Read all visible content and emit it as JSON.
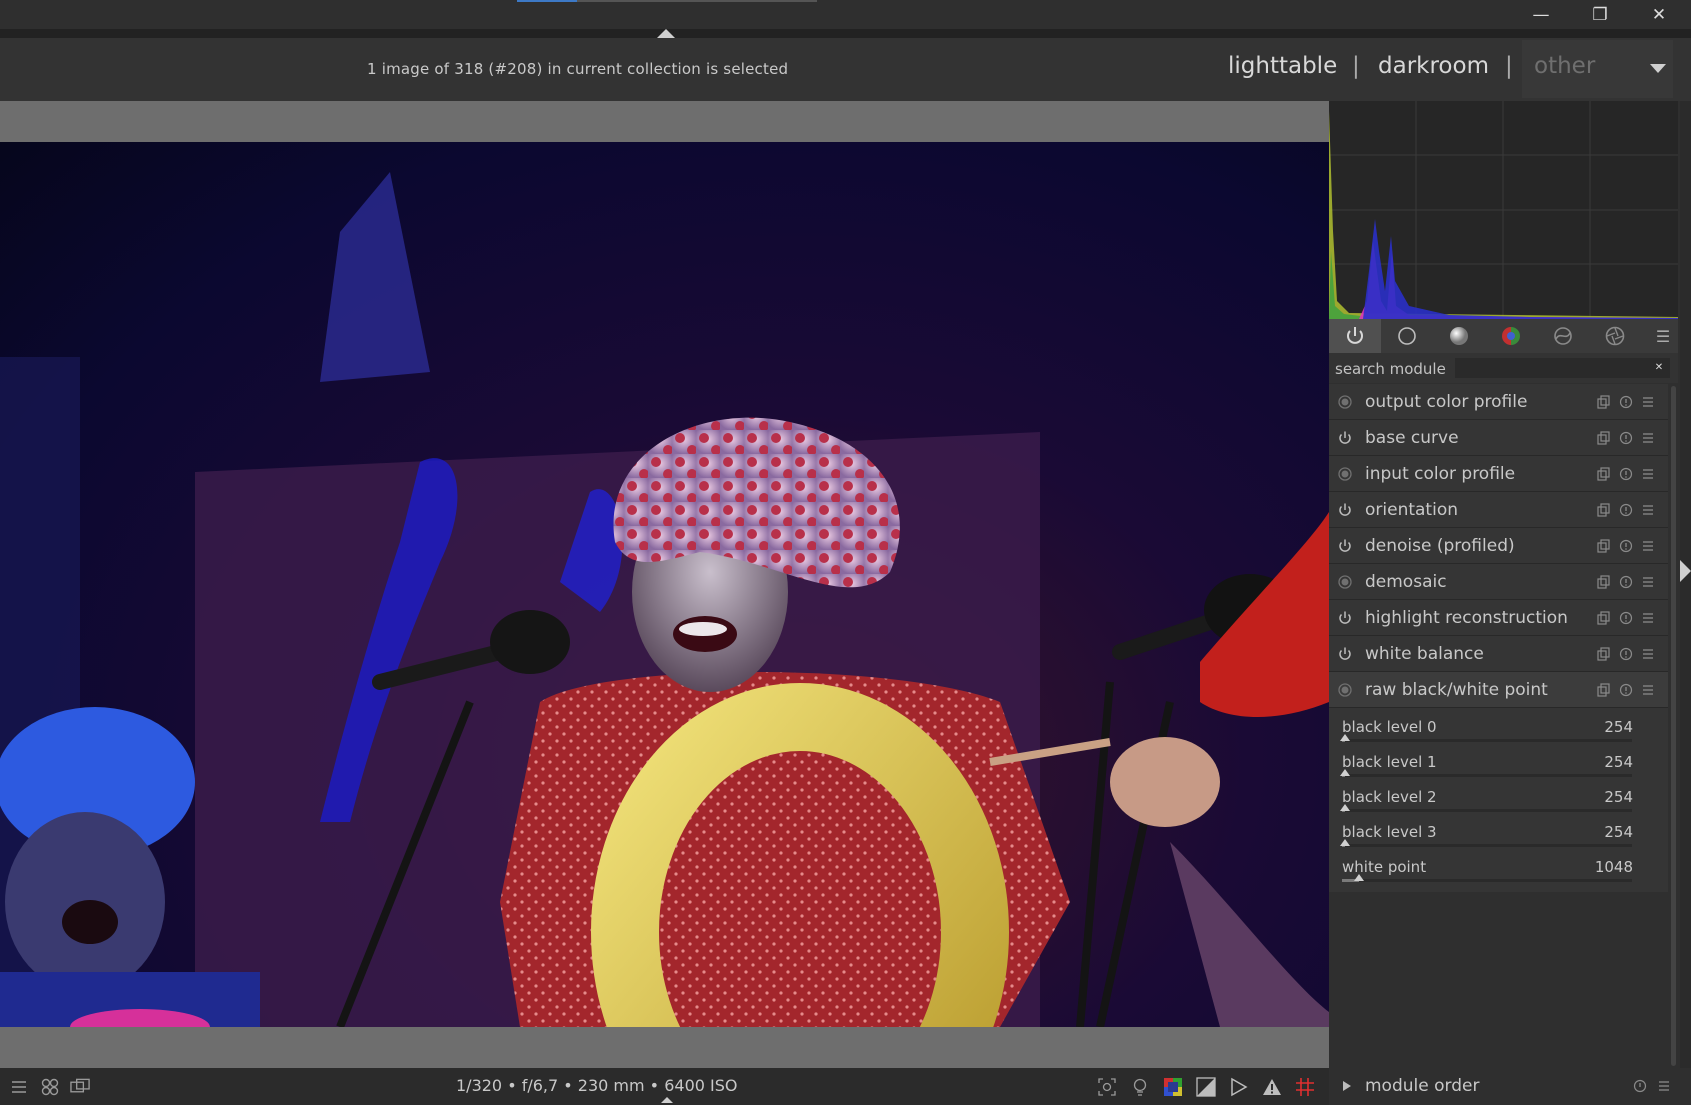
{
  "window": {
    "minimize_glyph": "—",
    "maximize_glyph": "❐",
    "close_glyph": "✕"
  },
  "header": {
    "status": "1 image of 318 (#208) in current collection is selected",
    "views": {
      "lighttable": "lighttable",
      "darkroom": "darkroom",
      "other": "other",
      "separator": "|"
    }
  },
  "module_groups": [
    {
      "name": "active-modules",
      "icon": "power-icon",
      "active": true
    },
    {
      "name": "base",
      "icon": "circle-outline-icon"
    },
    {
      "name": "tone",
      "icon": "sphere-icon"
    },
    {
      "name": "color",
      "icon": "color-wheel-icon"
    },
    {
      "name": "correct",
      "icon": "correct-icon"
    },
    {
      "name": "effect",
      "icon": "aperture-icon"
    }
  ],
  "search": {
    "label": "search module",
    "value": "",
    "placeholder": ""
  },
  "modules": [
    {
      "label": "output color profile",
      "state": "always-on"
    },
    {
      "label": "base curve",
      "state": "power"
    },
    {
      "label": "input color profile",
      "state": "always-on"
    },
    {
      "label": "orientation",
      "state": "power"
    },
    {
      "label": "denoise (profiled)",
      "state": "power"
    },
    {
      "label": "demosaic",
      "state": "always-on"
    },
    {
      "label": "highlight reconstruction",
      "state": "power"
    },
    {
      "label": "white balance",
      "state": "power"
    },
    {
      "label": "raw black/white point",
      "state": "always-on",
      "expanded": true
    }
  ],
  "raw_params": [
    {
      "label": "black level 0",
      "value": "254",
      "fraction": 0.01
    },
    {
      "label": "black level 1",
      "value": "254",
      "fraction": 0.01
    },
    {
      "label": "black level 2",
      "value": "254",
      "fraction": 0.01
    },
    {
      "label": "black level 3",
      "value": "254",
      "fraction": 0.01
    },
    {
      "label": "white point",
      "value": "1048",
      "fraction": 0.06
    }
  ],
  "bottom": {
    "exif": "1/320 • f/6,7 • 230 mm • 6400 ISO",
    "module_order": "module order"
  },
  "colors": {
    "accent": "#3d79c6",
    "panel": "#2f2f2f",
    "text": "#c8c8c8"
  }
}
